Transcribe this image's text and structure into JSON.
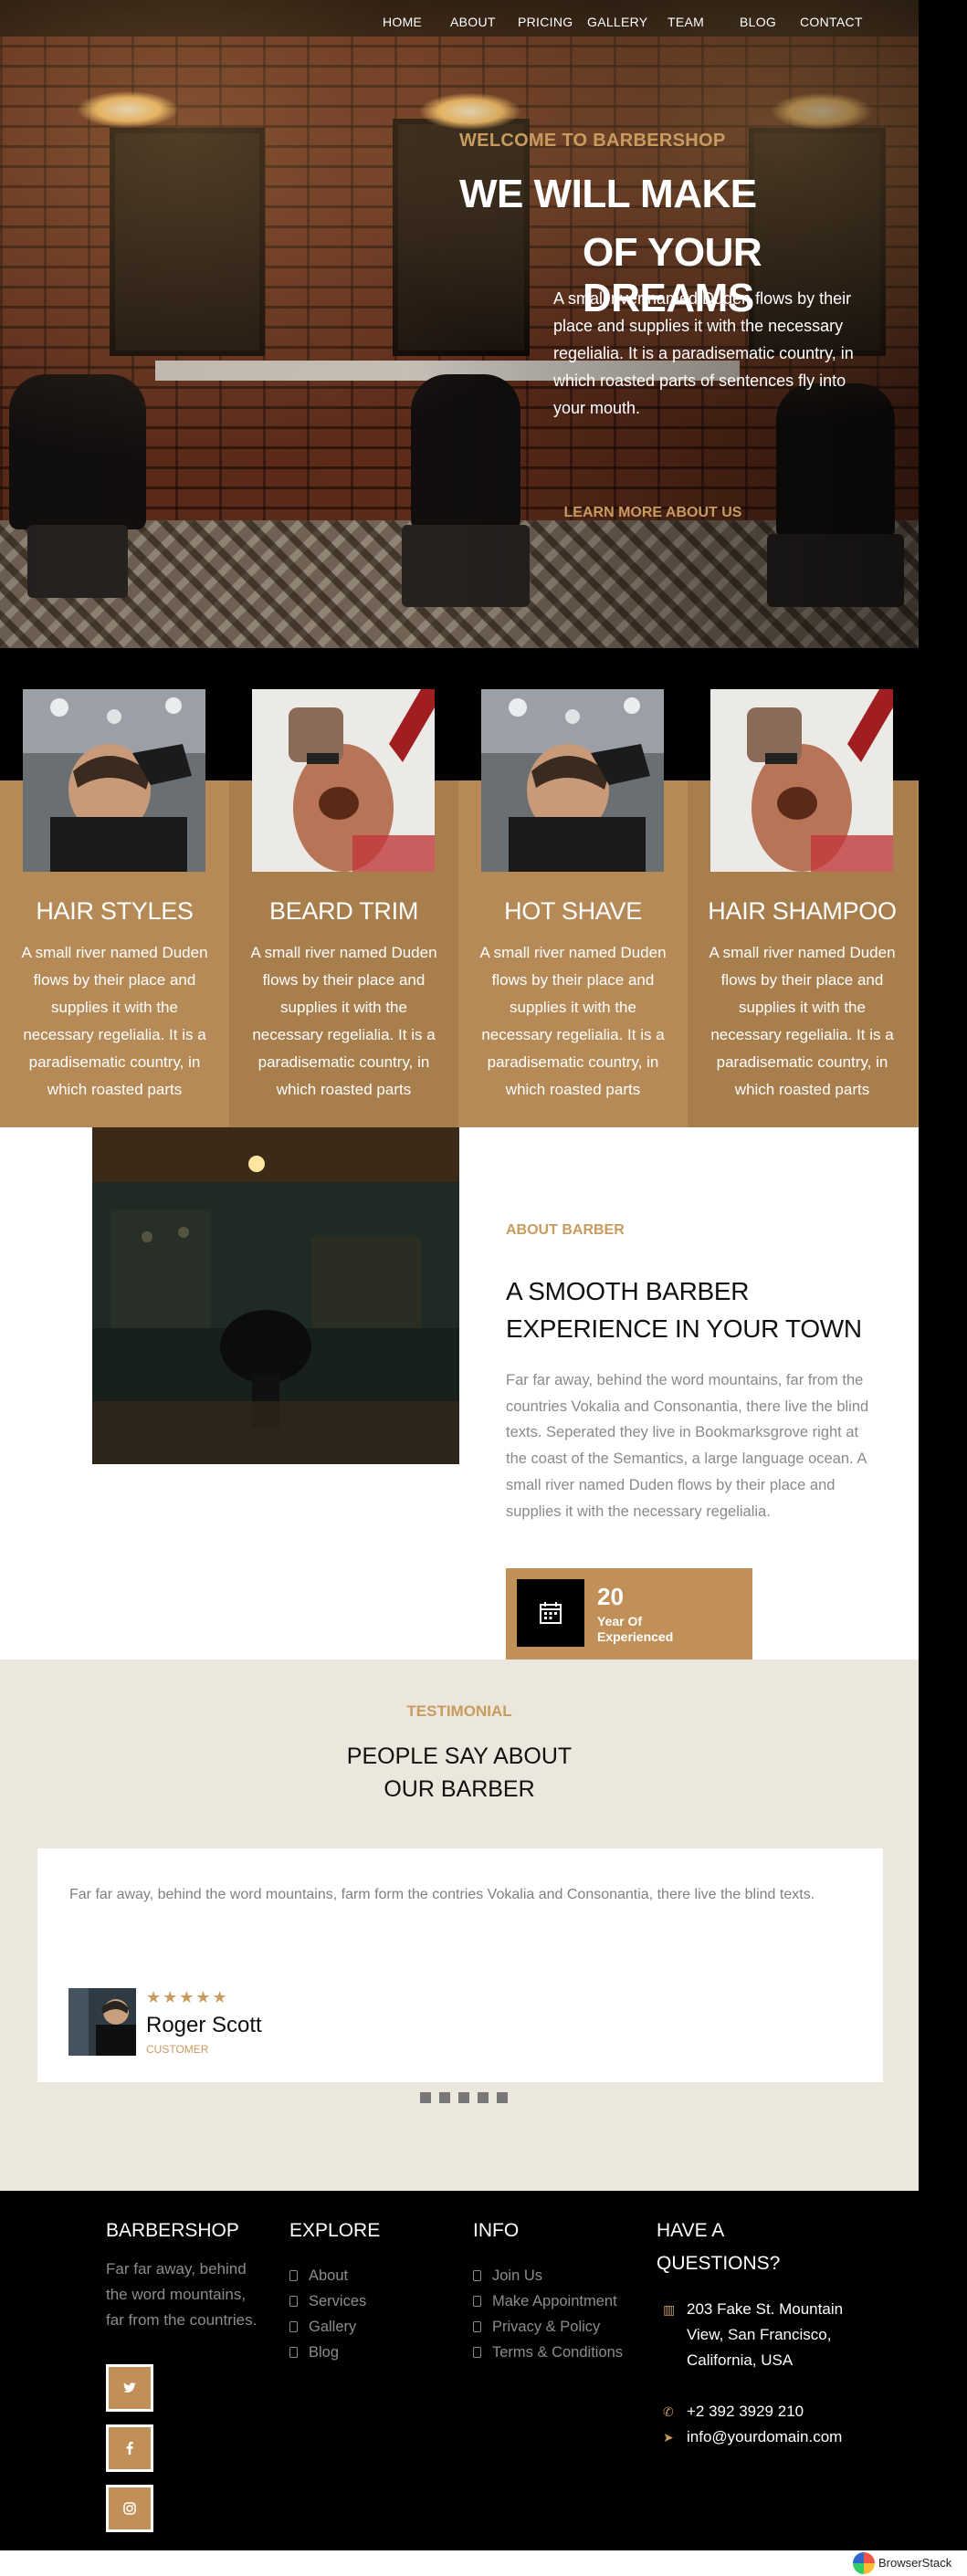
{
  "nav": {
    "items": [
      "HOME",
      "ABOUT",
      "PRICING",
      "GALLERY",
      "TEAM",
      "BLOG",
      "CONTACT"
    ]
  },
  "hero": {
    "subheading": "WELCOME TO BARBERSHOP",
    "title_line1": "WE WILL MAKE",
    "title_line2": "OF YOUR DREAMS",
    "text": "A small river named Duden flows by their place and supplies it with the necessary regelialia. It is a paradisematic country, in which roasted parts of sentences fly into your mouth.",
    "button": "LEARN MORE ABOUT US"
  },
  "services": [
    {
      "title": "HAIR STYLES",
      "text": "A small river named Duden flows by their place and supplies it with the necessary regelialia. It is a paradisematic country, in which roasted parts"
    },
    {
      "title": "BEARD TRIM",
      "text": "A small river named Duden flows by their place and supplies it with the necessary regelialia. It is a paradisematic country, in which roasted parts"
    },
    {
      "title": "HOT SHAVE",
      "text": "A small river named Duden flows by their place and supplies it with the necessary regelialia. It is a paradisematic country, in which roasted parts"
    },
    {
      "title": "HAIR SHAMPOO",
      "text": "A small river named Duden flows by their place and supplies it with the necessary regelialia. It is a paradisematic country, in which roasted parts"
    }
  ],
  "about": {
    "label": "ABOUT BARBER",
    "title": "A SMOOTH BARBER EXPERIENCE IN YOUR TOWN",
    "text": "Far far away, behind the word mountains, far from the countries Vokalia and Consonantia, there live the blind texts. Seperated they live in Bookmarksgrove right at the coast of the Semantics, a large language ocean. A small river named Duden flows by their place and supplies it with the necessary regelialia.",
    "experience_number": "20",
    "experience_label": "Year Of Experienced"
  },
  "testimonial": {
    "label": "TESTIMONIAL",
    "title_line1": "PEOPLE SAY ABOUT",
    "title_line2": "OUR BARBER",
    "quote": "Far far away, behind the word mountains, farm form the contries Vokalia and Consonantia, there live the blind texts.",
    "stars": "★★★★★",
    "name": "Roger Scott",
    "role": "CUSTOMER",
    "dot_count": 5
  },
  "footer": {
    "brand": "BARBERSHOP",
    "brand_text": "Far far away, behind the word mountains, far from the countries.",
    "social": [
      "twitter-icon",
      "facebook-icon",
      "instagram-icon"
    ],
    "explore_title": "EXPLORE",
    "explore_links": [
      "About",
      "Services",
      "Gallery",
      "Blog"
    ],
    "info_title": "INFO",
    "info_links": [
      "Join Us",
      "Make Appointment",
      "Privacy & Policy",
      "Terms & Conditions"
    ],
    "questions_title": "HAVE A QUESTIONS?",
    "address": "203 Fake St. Mountain View, San Francisco, California, USA",
    "phone": "+2 392 3929 210",
    "email": "info@yourdomain.com"
  },
  "browserstack": "BrowserStack",
  "colors": {
    "accent": "#c89b5f",
    "tile": "#b58a57",
    "tile_alt": "#a87e4d",
    "testimonial_bg": "#ebe7dc"
  }
}
